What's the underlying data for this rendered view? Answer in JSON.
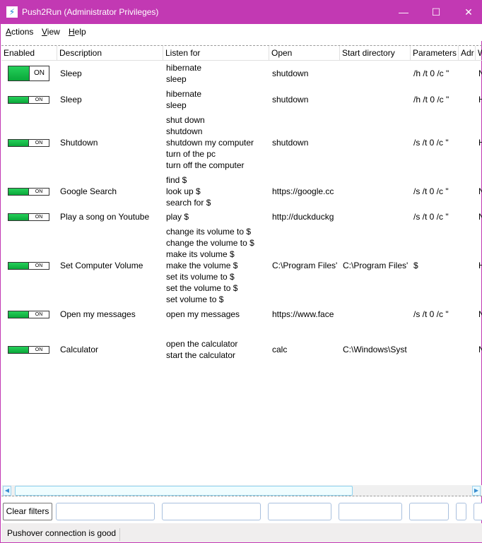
{
  "window": {
    "title": "Push2Run (Administrator Privileges)",
    "accent": "#c239b3",
    "minimize": "—",
    "maximize": "☐",
    "close": "✕"
  },
  "menu": [
    {
      "label": "Actions",
      "key": "A",
      "rest": "ctions"
    },
    {
      "label": "View",
      "key": "V",
      "rest": "iew"
    },
    {
      "label": "Help",
      "key": "H",
      "rest": "elp"
    }
  ],
  "columns": [
    "Enabled",
    "Description",
    "Listen for",
    "Open",
    "Start directory",
    "Parameters",
    "Adr",
    "W"
  ],
  "toggle_label": "ON",
  "rows": [
    {
      "enabled": true,
      "description": "Sleep",
      "listen": [
        "hibernate",
        "sleep"
      ],
      "open": "shutdown",
      "start_dir": "",
      "params": "/h /t 0 /c \"",
      "w": "N"
    },
    {
      "enabled": true,
      "description": "Sleep",
      "listen": [
        "hibernate",
        "sleep"
      ],
      "open": "shutdown",
      "start_dir": "",
      "params": "/h /t 0 /c \"",
      "w": "H"
    },
    {
      "enabled": true,
      "description": "Shutdown",
      "listen": [
        "shut down",
        "shutdown",
        "shutdown my computer",
        "turn of the pc",
        "turn off the computer"
      ],
      "open": "shutdown",
      "start_dir": "",
      "params": "/s /t 0 /c \"",
      "w": "H"
    },
    {
      "enabled": true,
      "description": "Google Search",
      "listen": [
        "find $",
        "look up $",
        "search for $"
      ],
      "open": "https://google.cc",
      "start_dir": "",
      "params": "/s /t 0 /c \"",
      "w": "N"
    },
    {
      "enabled": true,
      "description": "Play a song on Youtube",
      "listen": [
        "play $"
      ],
      "open": "http://duckduckg",
      "start_dir": "",
      "params": "/s /t 0 /c \"",
      "w": "N"
    },
    {
      "enabled": true,
      "description": "Set Computer Volume",
      "listen": [
        "change its volume to $",
        "change the volume to $",
        "make its volume $",
        "make the volume $",
        "set its volume to $",
        "set the volume to $",
        "set volume to $"
      ],
      "open": "C:\\Program Files'",
      "start_dir": "C:\\Program Files'",
      "params": "$",
      "w": "H"
    },
    {
      "enabled": true,
      "description": "Open my messages",
      "listen": [
        "open my messages"
      ],
      "open": "https://www.face",
      "start_dir": "",
      "params": "/s /t 0 /c \"",
      "w": "N"
    },
    {
      "enabled": true,
      "description": "Calculator",
      "listen": [
        "open the calculator",
        "start the calculator"
      ],
      "open": "calc",
      "start_dir": "C:\\Windows\\Syst",
      "params": "",
      "w": "N"
    }
  ],
  "filters": {
    "clear_label": "Clear filters"
  },
  "status": "Pushover connection is good"
}
